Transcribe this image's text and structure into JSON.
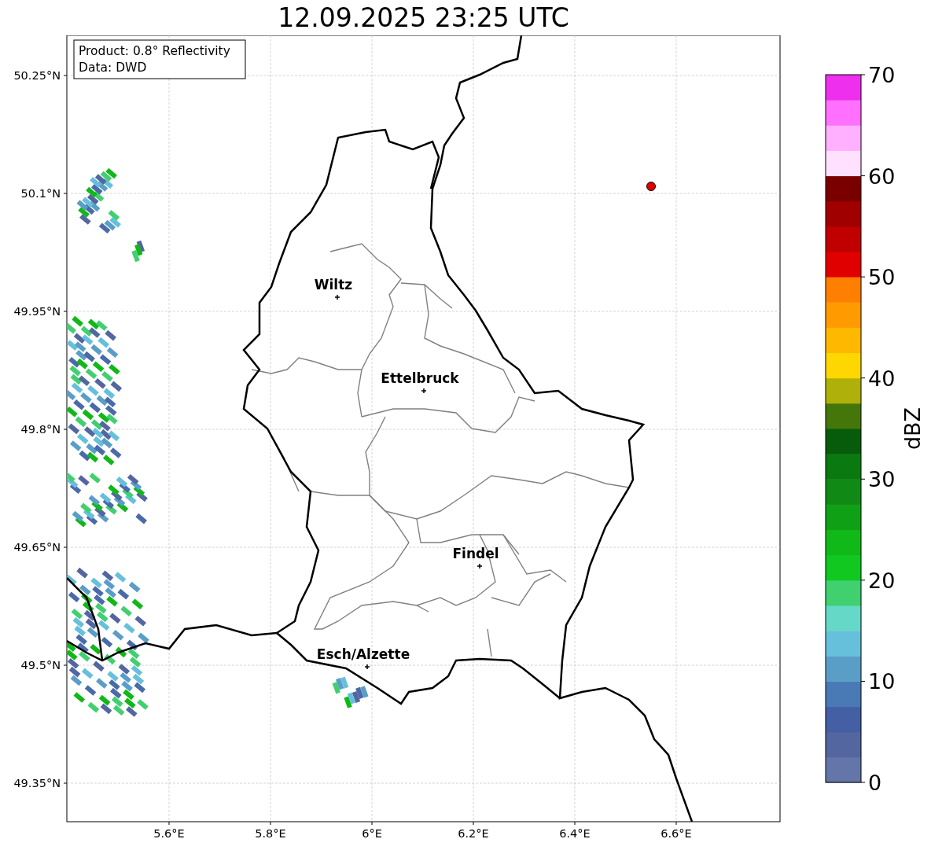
{
  "title": "12.09.2025 23:25 UTC",
  "info_box": [
    "Product: 0.8° Reflectivity",
    "Data: DWD"
  ],
  "yticks": [
    "50.25°N",
    "50.1°N",
    "49.95°N",
    "49.8°N",
    "49.65°N",
    "49.5°N",
    "49.35°N"
  ],
  "xticks": [
    "5.6°E",
    "5.8°E",
    "6°E",
    "6.2°E",
    "6.4°E",
    "6.6°E"
  ],
  "cities": [
    {
      "name": "Wiltz"
    },
    {
      "name": "Ettelbruck"
    },
    {
      "name": "Findel"
    },
    {
      "name": "Esch/Alzette"
    }
  ],
  "colorbar": {
    "label": "dBZ",
    "ticks": [
      "70",
      "60",
      "50",
      "40",
      "30",
      "20",
      "10",
      "0"
    ],
    "levels": [
      {
        "color": "#6475a9"
      },
      {
        "color": "#5466a0"
      },
      {
        "color": "#445fa3"
      },
      {
        "color": "#4a7ab5"
      },
      {
        "color": "#5a9ec8"
      },
      {
        "color": "#66c0db"
      },
      {
        "color": "#66d8c8"
      },
      {
        "color": "#40d070"
      },
      {
        "color": "#10c820"
      },
      {
        "color": "#10b818"
      },
      {
        "color": "#10a015"
      },
      {
        "color": "#108a15"
      },
      {
        "color": "#0a7a10"
      },
      {
        "color": "#065c0a"
      },
      {
        "color": "#44760a"
      },
      {
        "color": "#b0b00a"
      },
      {
        "color": "#ffd700"
      },
      {
        "color": "#ffb800"
      },
      {
        "color": "#ff9a00"
      },
      {
        "color": "#ff7f00"
      },
      {
        "color": "#e00000"
      },
      {
        "color": "#c00000"
      },
      {
        "color": "#a00000"
      },
      {
        "color": "#7a0000"
      },
      {
        "color": "#ffe0ff"
      },
      {
        "color": "#ffb0ff"
      },
      {
        "color": "#ff70ff"
      },
      {
        "color": "#ee30ee"
      }
    ]
  }
}
